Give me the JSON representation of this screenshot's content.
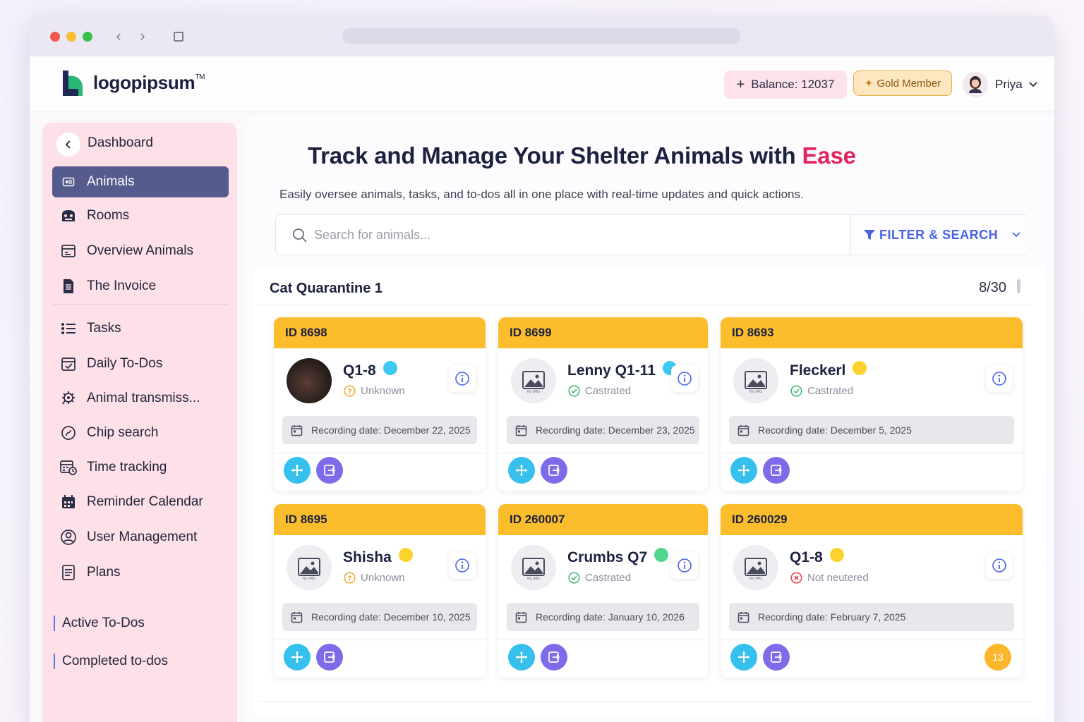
{
  "app": {
    "logo_text": "logopipsum",
    "logo_tm": "TM",
    "balance_label": "Balance: 12037",
    "member_label": "Gold Member",
    "user_name": "Priya"
  },
  "sidebar": {
    "dashboard": "Dashboard",
    "items": [
      {
        "label": "Animals",
        "icon": "animals-icon"
      },
      {
        "label": "Rooms",
        "icon": "rooms-icon"
      },
      {
        "label": "Overview Animals",
        "icon": "overview-icon"
      },
      {
        "label": "The Invoice",
        "icon": "invoice-icon"
      },
      {
        "label": "Tasks",
        "icon": "tasks-icon"
      },
      {
        "label": "Daily To-Dos",
        "icon": "calendar-check-icon"
      },
      {
        "label": "Animal transmiss...",
        "icon": "transmission-icon"
      },
      {
        "label": "Chip search",
        "icon": "chip-icon"
      },
      {
        "label": "Time tracking",
        "icon": "time-tracking-icon"
      },
      {
        "label": "Reminder Calendar",
        "icon": "reminder-calendar-icon"
      },
      {
        "label": "User Management",
        "icon": "user-icon"
      },
      {
        "label": "Plans",
        "icon": "plans-icon"
      }
    ],
    "active_todos": "Active To-Dos",
    "completed_todos": "Completed to-dos"
  },
  "main": {
    "headline_prefix": "Track and Manage Your Shelter Animals with ",
    "headline_accent": "Ease",
    "subline": "Easily oversee animals, tasks, and to-dos all in one place with real-time updates and quick actions.",
    "search_placeholder": "Search for animals...",
    "filter_label": "FILTER & SEARCH"
  },
  "room": {
    "title": "Cat Quarantine 1",
    "count": "8/30"
  },
  "cards": [
    {
      "id": "ID 8698",
      "name": "Q1-8",
      "dot_color": "#3ec9f2",
      "status": "Unknown",
      "status_type": "unknown",
      "date": "Recording date: December 22, 2025",
      "photo": true,
      "no_img": ""
    },
    {
      "id": "ID 8699",
      "name": "Lenny Q1-11",
      "dot_color": "#3ec9f2",
      "status": "Castrated",
      "status_type": "ok",
      "date": "Recording date: December 23, 2025",
      "photo": false,
      "no_img": "No IMG"
    },
    {
      "id": "ID 8693",
      "name": "Fleckerl",
      "dot_color": "#fcd22e",
      "status": "Castrated",
      "status_type": "ok",
      "date": "Recording date: December 5, 2025",
      "photo": false,
      "no_img": "No IMG"
    },
    {
      "id": "ID 8695",
      "name": "Shisha",
      "dot_color": "#fcd22e",
      "status": "Unknown",
      "status_type": "unknown",
      "date": "Recording date: December 10, 2025",
      "photo": false,
      "no_img": "No IMG"
    },
    {
      "id": "ID 260007",
      "name": "Crumbs Q7",
      "dot_color": "#4fd68e",
      "status": "Castrated",
      "status_type": "ok",
      "date": "Recording date: January 10, 2026",
      "photo": false,
      "no_img": "No IMG"
    },
    {
      "id": "ID 260029",
      "name": "Q1-8",
      "dot_color": "#fcd22e",
      "status": "Not neutered",
      "status_type": "no",
      "date": "Recording date: February 7, 2025",
      "photo": false,
      "no_img": "No IMG",
      "badge": "13"
    }
  ]
}
